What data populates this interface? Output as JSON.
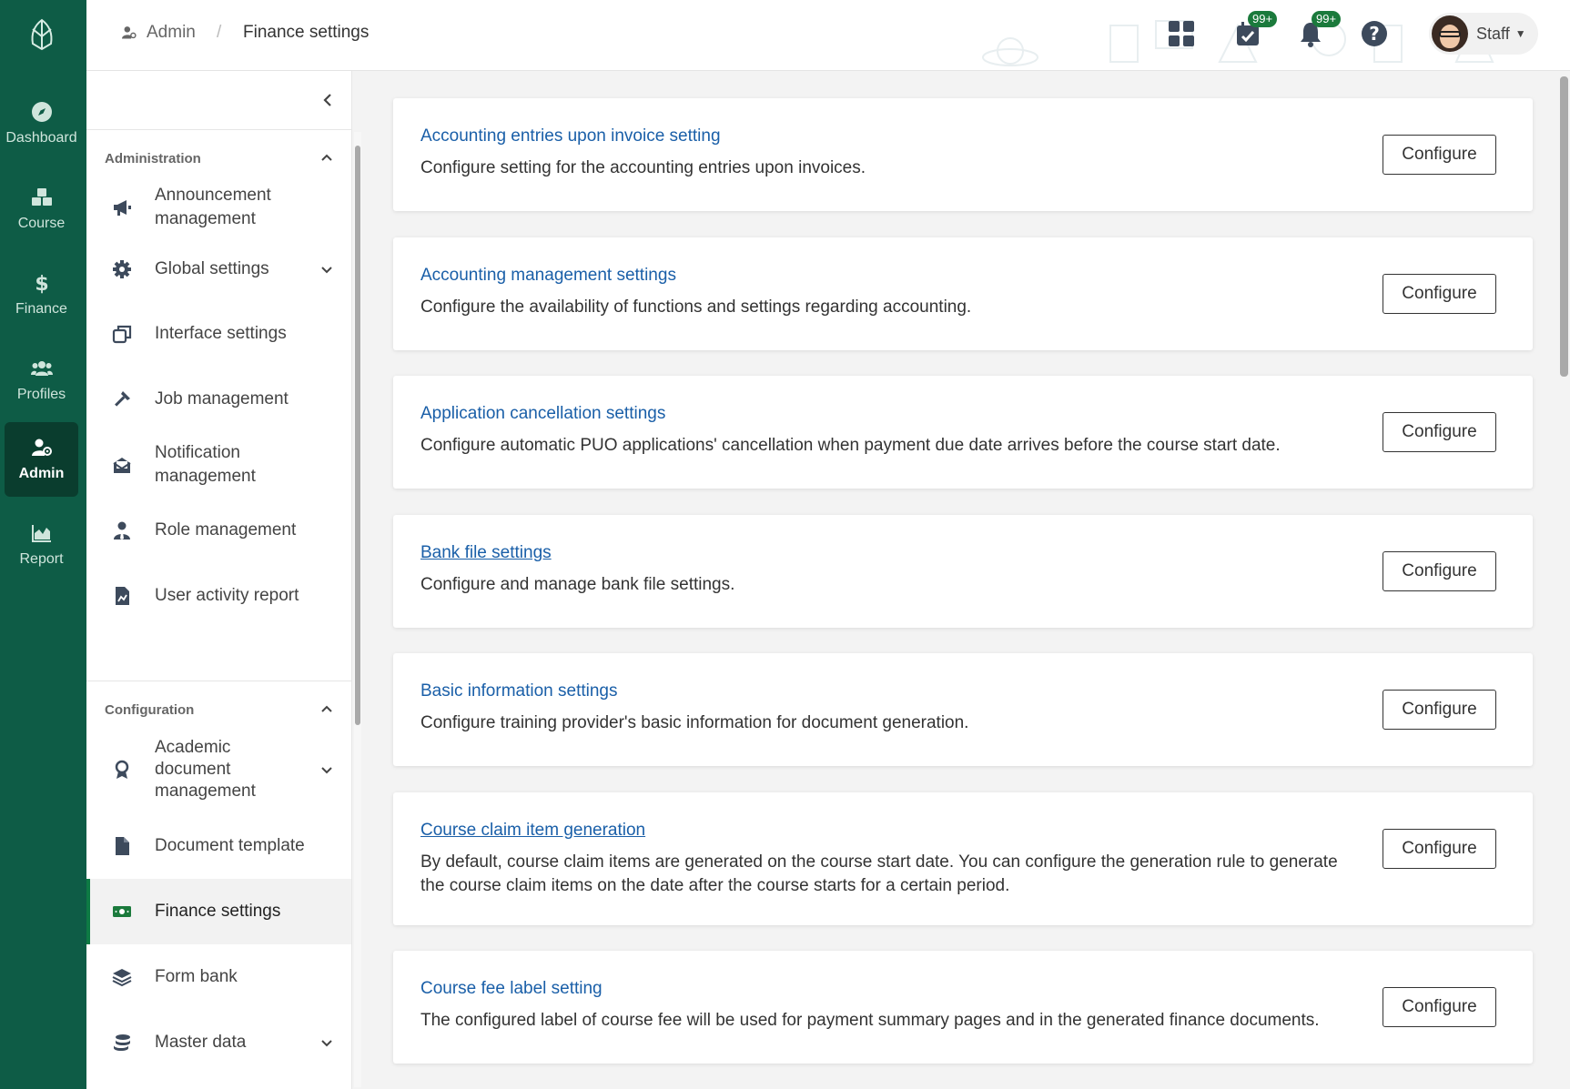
{
  "rail": {
    "items": [
      {
        "label": "Dashboard",
        "icon": "compass-icon"
      },
      {
        "label": "Course",
        "icon": "cubes-icon"
      },
      {
        "label": "Finance",
        "icon": "dollar-icon"
      },
      {
        "label": "Profiles",
        "icon": "users-icon"
      },
      {
        "label": "Admin",
        "icon": "user-gear-icon"
      },
      {
        "label": "Report",
        "icon": "area-chart-icon"
      }
    ]
  },
  "header": {
    "breadcrumb_root": "Admin",
    "breadcrumb_sep": "/",
    "breadcrumb_current": "Finance settings",
    "tasks_badge": "99+",
    "notifications_badge": "99+",
    "user_name": "Staff"
  },
  "subnav": {
    "administration_title": "Administration",
    "configuration_title": "Configuration",
    "administration_items": [
      {
        "label": "Announcement management"
      },
      {
        "label": "Global settings"
      },
      {
        "label": "Interface settings"
      },
      {
        "label": "Job management"
      },
      {
        "label": "Notification management"
      },
      {
        "label": "Role management"
      },
      {
        "label": "User activity report"
      }
    ],
    "configuration_items": [
      {
        "label": "Academic document management"
      },
      {
        "label": "Document template"
      },
      {
        "label": "Finance settings"
      },
      {
        "label": "Form bank"
      },
      {
        "label": "Master data"
      }
    ]
  },
  "cards": [
    {
      "title": "Accounting entries upon invoice setting",
      "desc": "Configure setting for the accounting entries upon invoices.",
      "button": "Configure"
    },
    {
      "title": "Accounting management settings",
      "desc": "Configure the availability of functions and settings regarding accounting.",
      "button": "Configure"
    },
    {
      "title": "Application cancellation settings",
      "desc": "Configure automatic PUO applications' cancellation when payment due date arrives before the course start date.",
      "button": "Configure"
    },
    {
      "title": "Bank file settings",
      "desc": "Configure and manage bank file settings.",
      "button": "Configure"
    },
    {
      "title": "Basic information settings",
      "desc": "Configure training provider's basic information for document generation.",
      "button": "Configure"
    },
    {
      "title": "Course claim item generation",
      "desc": "By default, course claim items are generated on the course start date. You can configure the generation rule to generate the course claim items on the date after the course starts for a certain period.",
      "button": "Configure"
    },
    {
      "title": "Course fee label setting",
      "desc": "The configured label of course fee will be used for payment summary pages and in the generated finance documents.",
      "button": "Configure"
    }
  ],
  "colors": {
    "rail": "#0e5c46",
    "rail_active": "#0a3d2e",
    "link": "#1a5fa8",
    "badge": "#1b7a3c"
  }
}
